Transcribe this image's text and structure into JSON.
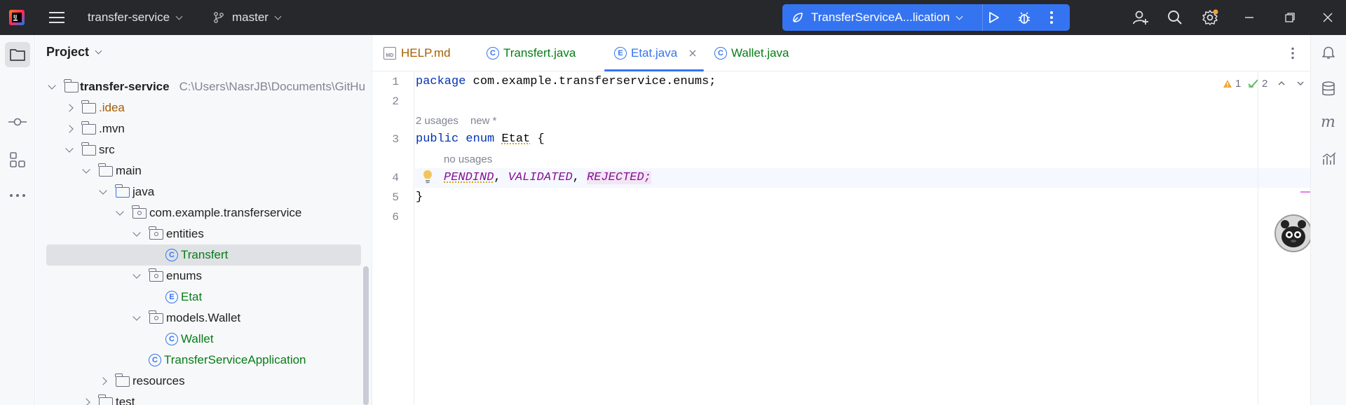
{
  "titlebar": {
    "project_name": "transfer-service",
    "branch": "master",
    "run_config": "TransferServiceA...lication"
  },
  "project_panel": {
    "title": "Project",
    "root": {
      "name": "transfer-service",
      "path": "C:\\Users\\NasrJB\\Documents\\GitHu"
    },
    "items": [
      {
        "label": "java"
      },
      {
        "label": ".idea"
      },
      {
        "label": ".mvn"
      },
      {
        "label": "src"
      },
      {
        "label": "main"
      },
      {
        "label": "com.example.transferservice"
      },
      {
        "label": "entities"
      },
      {
        "label": "Transfert"
      },
      {
        "label": "enums"
      },
      {
        "label": "Etat"
      },
      {
        "label": "models.Wallet"
      },
      {
        "label": "Wallet"
      },
      {
        "label": "TransferServiceApplication"
      },
      {
        "label": "resources"
      },
      {
        "label": "test"
      }
    ],
    "selected_item": "Transfert"
  },
  "tabs": [
    {
      "label": "HELP.md",
      "icon": "md-file-icon"
    },
    {
      "label": "Transfert.java",
      "icon": "class-icon"
    },
    {
      "label": "Etat.java",
      "icon": "enum-icon",
      "active": true
    },
    {
      "label": "Wallet.java",
      "icon": "class-icon"
    }
  ],
  "editor": {
    "line_numbers": [
      "1",
      "2",
      "3",
      "4",
      "5",
      "6"
    ],
    "line1": {
      "keyword": "package",
      "rest": " com.example.transferservice.enums;"
    },
    "hint_usages": "2 usages",
    "hint_new": "new *",
    "line3": {
      "kw1": "public",
      "kw2": "enum",
      "name": "Etat",
      "brace": " {"
    },
    "hint_no_usages": "no usages",
    "line4": {
      "c1": "PENDIND",
      "sep1": ", ",
      "c2": "VALIDATED",
      "sep2": ", ",
      "c3": "REJECTED",
      "end": ";"
    },
    "line5": "}",
    "warnings_count": "1",
    "checks_count": "2"
  },
  "enum_icon_letter": "E",
  "class_icon_letter": "C",
  "colors": {
    "titlebar_bg": "#27282c",
    "accent": "#3574f0",
    "keyword": "#0033b3",
    "enum_constant": "#871094",
    "file_green": "#067d17",
    "folder_orange": "#a65d00"
  }
}
